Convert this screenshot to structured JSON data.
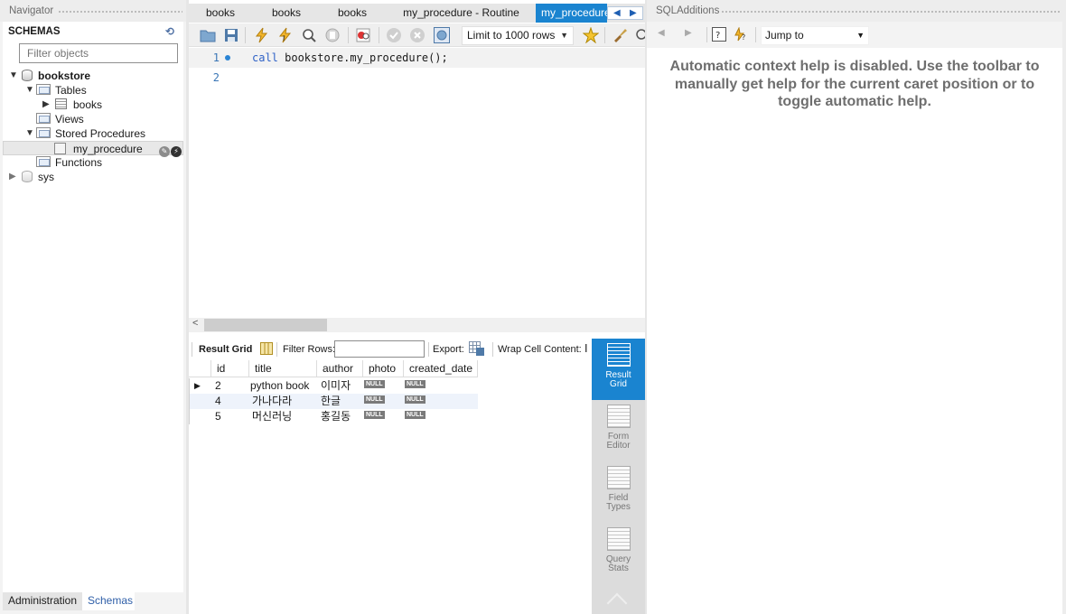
{
  "navigator": {
    "title": "Navigator",
    "schemas_label": "SCHEMAS",
    "filter_placeholder": "Filter objects",
    "tree": {
      "bookstore": "bookstore",
      "tables": "Tables",
      "books": "books",
      "views": "Views",
      "stored_procedures": "Stored Procedures",
      "my_procedure": "my_procedure",
      "functions": "Functions",
      "sys": "sys"
    },
    "bottom_tabs": [
      "Administration",
      "Schemas"
    ]
  },
  "editor": {
    "tabs": [
      "books",
      "books",
      "books",
      "my_procedure - Routine",
      "my_procedure"
    ],
    "limit_label": "Limit to 1000 rows",
    "lines": [
      {
        "num": "1",
        "keyword": "call",
        "rest": " bookstore.my_procedure();"
      },
      {
        "num": "2",
        "keyword": "",
        "rest": ""
      }
    ]
  },
  "results": {
    "result_grid_label": "Result Grid",
    "filter_rows_label": "Filter Rows:",
    "export_label": "Export:",
    "wrap_label": "Wrap Cell Content:",
    "columns": [
      "id",
      "title",
      "author",
      "photo",
      "created_date"
    ],
    "rows": [
      {
        "id": "2",
        "title": "python book",
        "author": "이미자",
        "photo": "NULL",
        "created_date": "NULL"
      },
      {
        "id": "4",
        "title": "가나다라",
        "author": "한글",
        "photo": "NULL",
        "created_date": "NULL"
      },
      {
        "id": "5",
        "title": "머신러닝",
        "author": "홍길동",
        "photo": "NULL",
        "created_date": "NULL"
      }
    ],
    "side_buttons": [
      {
        "line1": "Result",
        "line2": "Grid"
      },
      {
        "line1": "Form",
        "line2": "Editor"
      },
      {
        "line1": "Field",
        "line2": "Types"
      },
      {
        "line1": "Query",
        "line2": "Stats"
      }
    ]
  },
  "additions": {
    "title": "SQLAdditions",
    "jump_to": "Jump to",
    "help_text": "Automatic context help is disabled. Use the toolbar to manually get help for the current caret position or to toggle automatic help."
  },
  "colors": {
    "accent": "#1a84d0",
    "keyword": "#2f62c7",
    "link": "#2f5fa8"
  }
}
